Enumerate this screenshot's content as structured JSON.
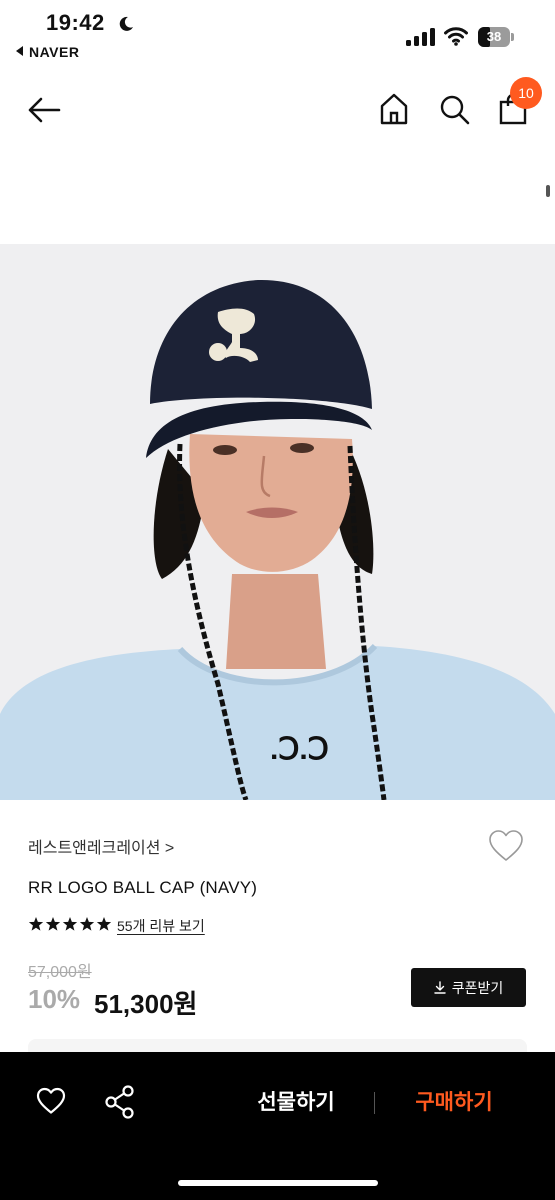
{
  "status_bar": {
    "time": "19:42",
    "back_app": "NAVER",
    "battery": "38",
    "battery_level": 0.38,
    "icons": [
      "moon-icon",
      "signal-icon",
      "wifi-icon",
      "battery-icon"
    ]
  },
  "nav": {
    "icons": [
      "back-arrow-icon",
      "home-icon",
      "search-icon",
      "cart-icon"
    ],
    "cart_count": "10"
  },
  "product": {
    "image_icon": "product-photo",
    "brand": "레스트앤레크레이션 >",
    "title": "RR LOGO BALL CAP (NAVY)",
    "rating_stars": 5,
    "review_link": "55개 리뷰 보기",
    "original_price": "57,000원",
    "discount": "10%",
    "sale_price": "51,300원",
    "coupon_label": "쿠폰받기"
  },
  "bottom_bar": {
    "icons": [
      "heart-icon",
      "share-icon"
    ],
    "gift_label": "선물하기",
    "buy_label": "구매하기"
  },
  "colors": {
    "accent": "#ff5a1f",
    "bar_bg": "#000000",
    "cap_navy": "#1c2236",
    "sweater": "#c4dbed",
    "backdrop": "#efeff1"
  }
}
